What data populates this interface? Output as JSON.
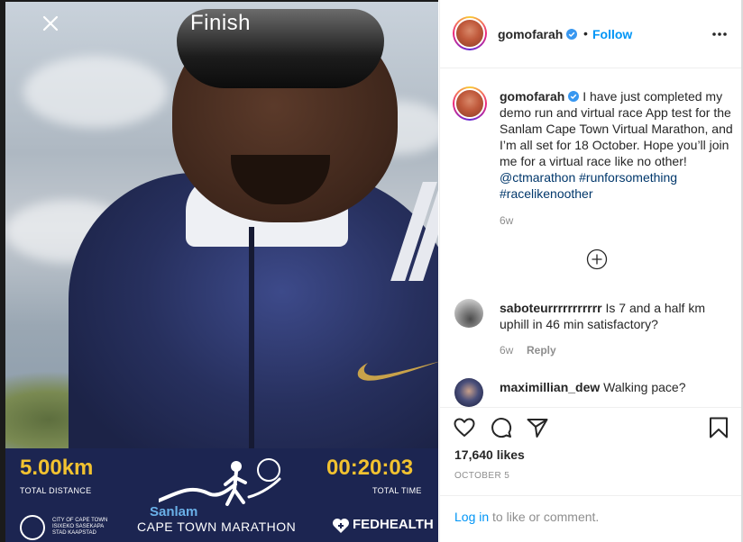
{
  "media": {
    "overlay_title": "Finish",
    "distance_value": "5.00km",
    "distance_label": "TOTAL DISTANCE",
    "time_value": "00:20:03",
    "time_label": "TOTAL TIME",
    "city_text": "CITY OF CAPE TOWN\nISIXEKO SASEKAPA\nSTAD KAAPSTAD",
    "sponsor_name": "Sanlam",
    "race_name": "CAPE TOWN MARATHON",
    "partner_name": "FEDHEALTH",
    "colors": {
      "banner": "#1c2551",
      "stat": "#f2c230",
      "sanlam": "#6ab0e8"
    }
  },
  "header": {
    "username": "gomofarah",
    "separator": "•",
    "follow_label": "Follow",
    "verified_icon": "verified-badge-icon",
    "more_icon": "more-options-icon"
  },
  "caption": {
    "username": "gomofarah",
    "text": "I have just completed my demo run and virtual race App test for the Sanlam Cape Town Virtual Marathon, and I’m all set for 18 October. Hope you’ll join me for a virtual race like no other!",
    "mention": "@ctmarathon",
    "hashtag1": "#runforsomething",
    "hashtag2": "#racelikenoother",
    "age": "6w"
  },
  "comments": [
    {
      "username": "saboteurrrrrrrrrrr",
      "text": "Is 7 and a half km uphill in 46 min satisfactory?",
      "age": "6w",
      "reply_label": "Reply"
    },
    {
      "username": "maximillian_dew",
      "text": "Walking pace?"
    }
  ],
  "actions": {
    "likes": "17,640 likes",
    "date": "OCTOBER 5",
    "login_link": "Log in",
    "login_rest": " to like or comment."
  },
  "colors": {
    "accent": "#0095f6",
    "link": "#00376b",
    "muted": "#8e8e8e"
  }
}
